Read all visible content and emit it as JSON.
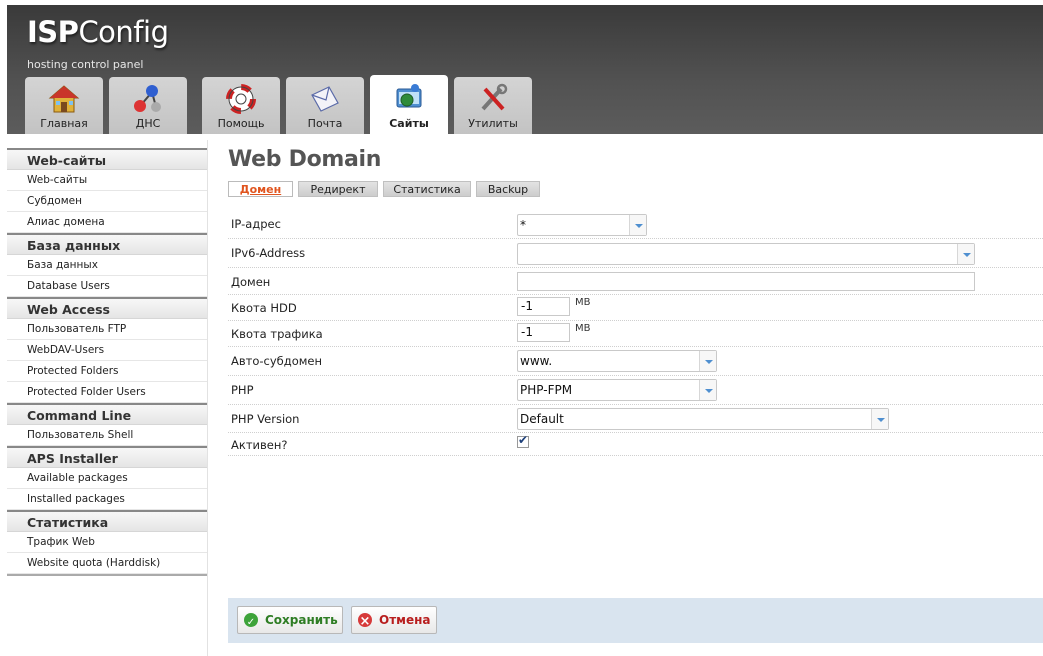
{
  "header": {
    "logo_bold": "ISP",
    "logo_rest": "Config",
    "subtitle": "hosting control panel"
  },
  "tabs": [
    {
      "label": "Главная",
      "icon": "home-icon",
      "active": false
    },
    {
      "label": "ДНС",
      "icon": "dns-icon",
      "active": false
    },
    {
      "label": "Помощь",
      "icon": "lifebuoy-icon",
      "active": false
    },
    {
      "label": "Почта",
      "icon": "mail-icon",
      "active": false
    },
    {
      "label": "Сайты",
      "icon": "sites-icon",
      "active": true
    },
    {
      "label": "Утилиты",
      "icon": "tools-icon",
      "active": false
    }
  ],
  "sidebar": {
    "sections": [
      {
        "title": "Web-сайты",
        "items": [
          "Web-сайты",
          "Субдомен",
          "Алиас домена"
        ]
      },
      {
        "title": "База данных",
        "items": [
          "База данных",
          "Database Users"
        ]
      },
      {
        "title": "Web Access",
        "items": [
          "Пользователь FTP",
          "WebDAV-Users",
          "Protected Folders",
          "Protected Folder Users"
        ]
      },
      {
        "title": "Command Line",
        "items": [
          "Пользователь Shell"
        ]
      },
      {
        "title": "APS Installer",
        "items": [
          "Available packages",
          "Installed packages"
        ]
      },
      {
        "title": "Статистика",
        "items": [
          "Трафик Web",
          "Website quota (Harddisk)"
        ]
      }
    ]
  },
  "main": {
    "title": "Web Domain",
    "subtabs": [
      "Домен",
      "Редирект",
      "Статистика",
      "Backup"
    ],
    "fields": {
      "ip": {
        "label": "IP-адрес",
        "value": "*"
      },
      "ipv6": {
        "label": "IPv6-Address",
        "value": ""
      },
      "domain": {
        "label": "Домен",
        "value": ""
      },
      "hdd_quota": {
        "label": "Квота HDD",
        "value": "-1",
        "unit": "MB"
      },
      "traffic_quota": {
        "label": "Квота трафика",
        "value": "-1",
        "unit": "MB"
      },
      "auto_subdomain": {
        "label": "Авто-субдомен",
        "value": "www."
      },
      "php": {
        "label": "PHP",
        "value": "PHP-FPM"
      },
      "php_version": {
        "label": "PHP Version",
        "value": "Default"
      },
      "active": {
        "label": "Активен?",
        "checked": true
      }
    },
    "buttons": {
      "save": "Сохранить",
      "cancel": "Отмена"
    }
  },
  "colors": {
    "header_bg": "#4a4a4a",
    "active_subtab": "#e0541e",
    "button_bar": "#d9e4ef",
    "select_arrow": "#4f8fd0"
  }
}
